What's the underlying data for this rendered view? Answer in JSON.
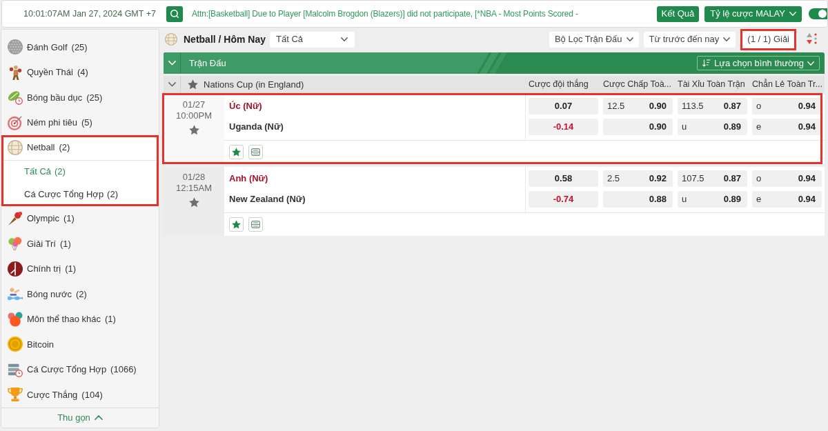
{
  "top_bar": {
    "clock": "10:01:07AM Jan 27, 2024 GMT +7",
    "announcement": "Attn:[Basketball] Due to Player [Malcolm Brogdon (Blazers)] did not participate, [*NBA - Most Points Scored -",
    "buttons": [
      {
        "label": "Kết Quả",
        "kind": "plain"
      },
      {
        "label": "Tỷ lệ cược MALAY",
        "kind": "dropdown"
      }
    ],
    "toggle": {
      "on": true
    }
  },
  "sidebar": {
    "items": [
      {
        "name": "Đánh Golf",
        "count": "(25)",
        "expanded": false,
        "highlighted": false
      },
      {
        "name": "Quyền Thái",
        "count": "(4)",
        "expanded": false,
        "highlighted": false
      },
      {
        "name": "Bóng bầu dục",
        "count": "(25)",
        "expanded": false,
        "highlighted": false
      },
      {
        "name": "Ném phi tiêu",
        "count": "(5)",
        "expanded": false,
        "highlighted": false
      },
      {
        "name": "Netball",
        "count": "(2)",
        "expanded": true,
        "highlighted": true,
        "children": [
          {
            "name": "Tất Cả",
            "count": "(2)",
            "selected": true
          },
          {
            "name": "Cá Cược Tổng Hợp",
            "count": "(2)",
            "selected": false
          }
        ]
      },
      {
        "name": "Olympic",
        "count": "(1)",
        "expanded": false,
        "highlighted": false
      },
      {
        "name": "Giải Trí",
        "count": "(1)",
        "expanded": false,
        "highlighted": false
      },
      {
        "name": "Chính trị",
        "count": "(1)",
        "expanded": false,
        "highlighted": false
      },
      {
        "name": "Bóng nước",
        "count": "(2)",
        "expanded": false,
        "highlighted": false
      },
      {
        "name": "Môn thể thao khác",
        "count": "(1)",
        "expanded": false,
        "highlighted": false
      },
      {
        "name": "Bitcoin",
        "expanded": false,
        "highlighted": false
      },
      {
        "name": "Cá Cược Tổng Hợp",
        "count": "(1066)",
        "expanded": false,
        "highlighted": false
      },
      {
        "name": "Cược Thắng",
        "count": "(104)",
        "expanded": false,
        "highlighted": false
      }
    ],
    "collapse_label": "Thu gọn"
  },
  "header": {
    "breadcrumb": "Netball / Hôm Nay",
    "market_filter": "Tất Cả",
    "filters": [
      "Bộ Lọc Trận Đấu",
      "Từ trước đến nay"
    ],
    "league_counter": {
      "label": "(1 / 1) Giải",
      "highlighted": true
    }
  },
  "section": {
    "title": "Trận Đấu",
    "expanded": true,
    "view_option": "Lựa chọn bình thường"
  },
  "league": {
    "name": "Nations Cup (in England)",
    "expanded": true,
    "favorite": false,
    "columns": [
      "Cược đội thắng",
      "Cược Chấp Toà...",
      "Tài Xỉu Toàn Trận",
      "Chẳn Lẻ Toàn Tr..."
    ]
  },
  "matches": [
    {
      "date": "01/27",
      "time": "10:00PM",
      "favorite": false,
      "highlighted": true,
      "teams": [
        {
          "name": "Úc (Nữ)",
          "favored": true
        },
        {
          "name": "Uganda (Nữ)",
          "favored": false
        }
      ],
      "odds": [
        [
          {
            "price": "0.07",
            "negative": false
          },
          {
            "line": "12.5",
            "price": "0.90",
            "negative": false
          },
          {
            "line": "113.5",
            "price": "0.87",
            "negative": false
          },
          {
            "line": "o",
            "price": "0.94",
            "negative": false
          }
        ],
        [
          {
            "price": "-0.14",
            "negative": true
          },
          {
            "price": "0.90",
            "negative": false
          },
          {
            "line": "u",
            "price": "0.89",
            "negative": false
          },
          {
            "line": "e",
            "price": "0.94",
            "negative": false
          }
        ]
      ]
    },
    {
      "date": "01/28",
      "time": "12:15AM",
      "favorite": false,
      "highlighted": false,
      "teams": [
        {
          "name": "Anh (Nữ)",
          "favored": true
        },
        {
          "name": "New Zealand (Nữ)",
          "favored": false
        }
      ],
      "odds": [
        [
          {
            "price": "0.58",
            "negative": false
          },
          {
            "line": "2.5",
            "price": "0.92",
            "negative": false
          },
          {
            "line": "107.5",
            "price": "0.87",
            "negative": false
          },
          {
            "line": "o",
            "price": "0.94",
            "negative": false
          }
        ],
        [
          {
            "price": "-0.74",
            "negative": true
          },
          {
            "price": "0.88",
            "negative": false
          },
          {
            "line": "u",
            "price": "0.89",
            "negative": false
          },
          {
            "line": "e",
            "price": "0.94",
            "negative": false
          }
        ]
      ]
    }
  ]
}
